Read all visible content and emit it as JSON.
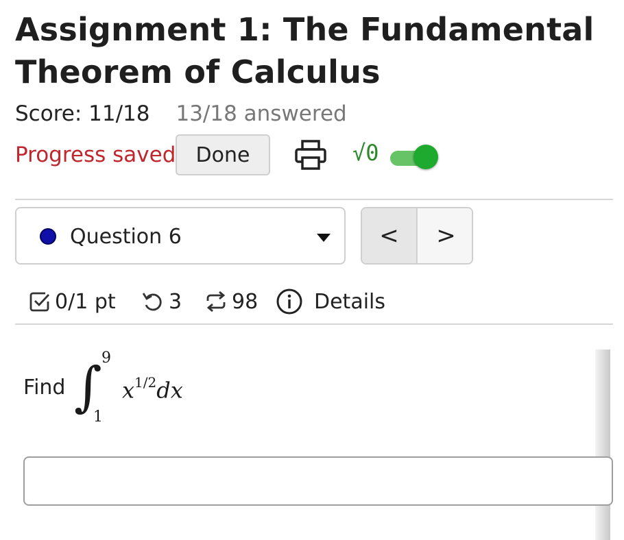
{
  "assignment": {
    "title": "Assignment 1: The Fundamental Theorem of Calculus",
    "score": "Score: 11/18",
    "answered": "13/18 answered"
  },
  "toolbar": {
    "progress_status": "Progress saved",
    "done_label": "Done",
    "print_icon": "printer-icon",
    "math_toggle_label": "√0",
    "math_toggle_on": true,
    "accent_green": "#1eaa2e",
    "status_red": "#c0262b"
  },
  "question_nav": {
    "selected_question": "Question 6",
    "status_dot_color": "#1010a8",
    "prev_label": "<",
    "next_label": ">"
  },
  "question_meta": {
    "points": "0/1 pt",
    "retries": "3",
    "attempts": "98",
    "details_label": "Details"
  },
  "question": {
    "prompt": "Find",
    "integral_upper": "9",
    "integral_lower": "1",
    "integrand_base": "x",
    "integrand_exponent": "1/2",
    "differential": "dx",
    "answer_value": ""
  }
}
